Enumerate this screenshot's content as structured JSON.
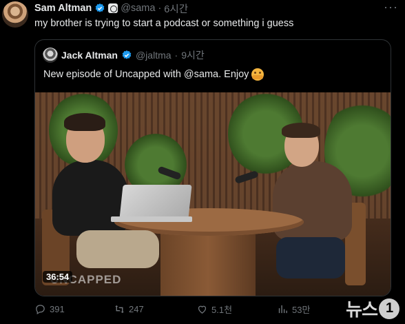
{
  "tweet": {
    "author_name": "Sam Altman",
    "handle": "@sama",
    "separator": "·",
    "time": "6시간",
    "more_label": "···",
    "text": "my brother is trying to start a podcast or something i guess"
  },
  "quote": {
    "author_name": "Jack Altman",
    "handle": "@jaltma",
    "separator": "·",
    "time": "9시간",
    "text": "New episode of Uncapped with @sama. Enjoy",
    "emoji": "hugging-face-icon",
    "video": {
      "duration": "36:54",
      "overlay_text": "UNCAPPED"
    }
  },
  "actions": {
    "replies": "391",
    "reposts": "247",
    "likes": "5.1천",
    "views": "53만"
  },
  "watermark": {
    "text": "뉴스",
    "badge": "1"
  },
  "colors": {
    "background": "#000000",
    "text": "#e7e9ea",
    "muted": "#71767b",
    "verified": "#1d9bf0",
    "border": "#2f3336"
  }
}
